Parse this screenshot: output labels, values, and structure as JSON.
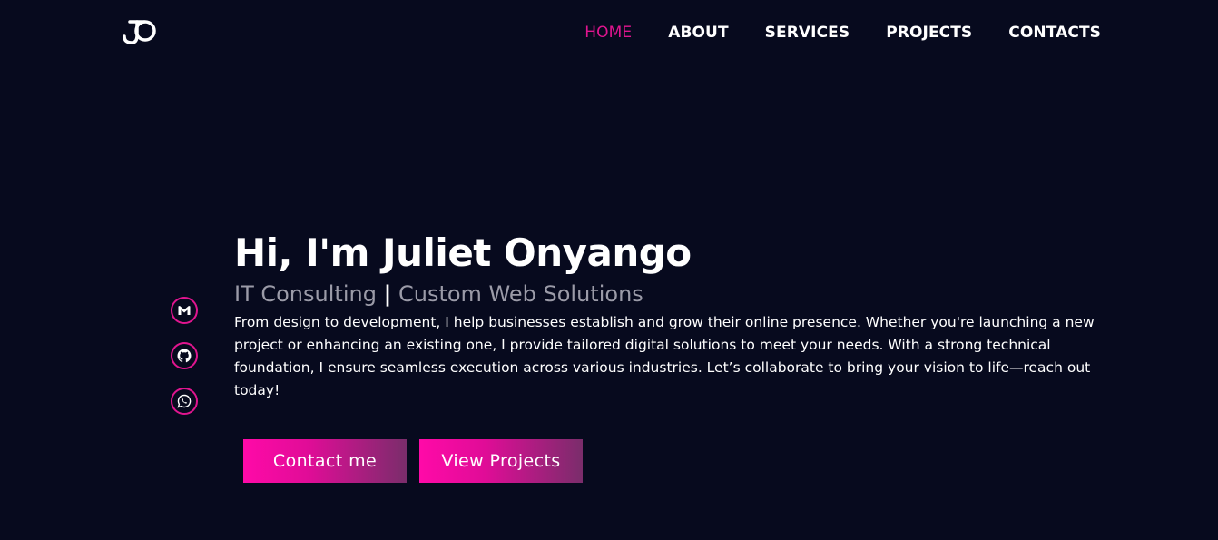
{
  "header": {
    "nav": [
      {
        "label": "HOME",
        "active": true
      },
      {
        "label": "ABOUT",
        "active": false
      },
      {
        "label": "SERVICES",
        "active": false
      },
      {
        "label": "PROJECTS",
        "active": false
      },
      {
        "label": "CONTACTS",
        "active": false
      }
    ]
  },
  "socials": [
    {
      "icon": "gmail-icon"
    },
    {
      "icon": "github-icon"
    },
    {
      "icon": "whatsapp-icon"
    }
  ],
  "hero": {
    "title": "Hi, I'm Juliet Onyango",
    "subtitle_left": "IT Consulting",
    "subtitle_sep": "|",
    "subtitle_right": "Custom Web Solutions",
    "description": "From design to development, I help businesses establish and grow their online presence. Whether you're launching a new project or enhancing an existing one, I provide tailored digital solutions to meet your needs. With a strong technical foundation, I ensure seamless execution across various industries. Let’s collaborate to bring your vision to life—reach out today!"
  },
  "buttons": {
    "contact": "Contact me",
    "projects": "View Projects"
  },
  "colors": {
    "background": "#070a1e",
    "accent": "#e0158f",
    "gradient_end": "#7a2d6b",
    "subtitle": "#9b9ba8"
  }
}
